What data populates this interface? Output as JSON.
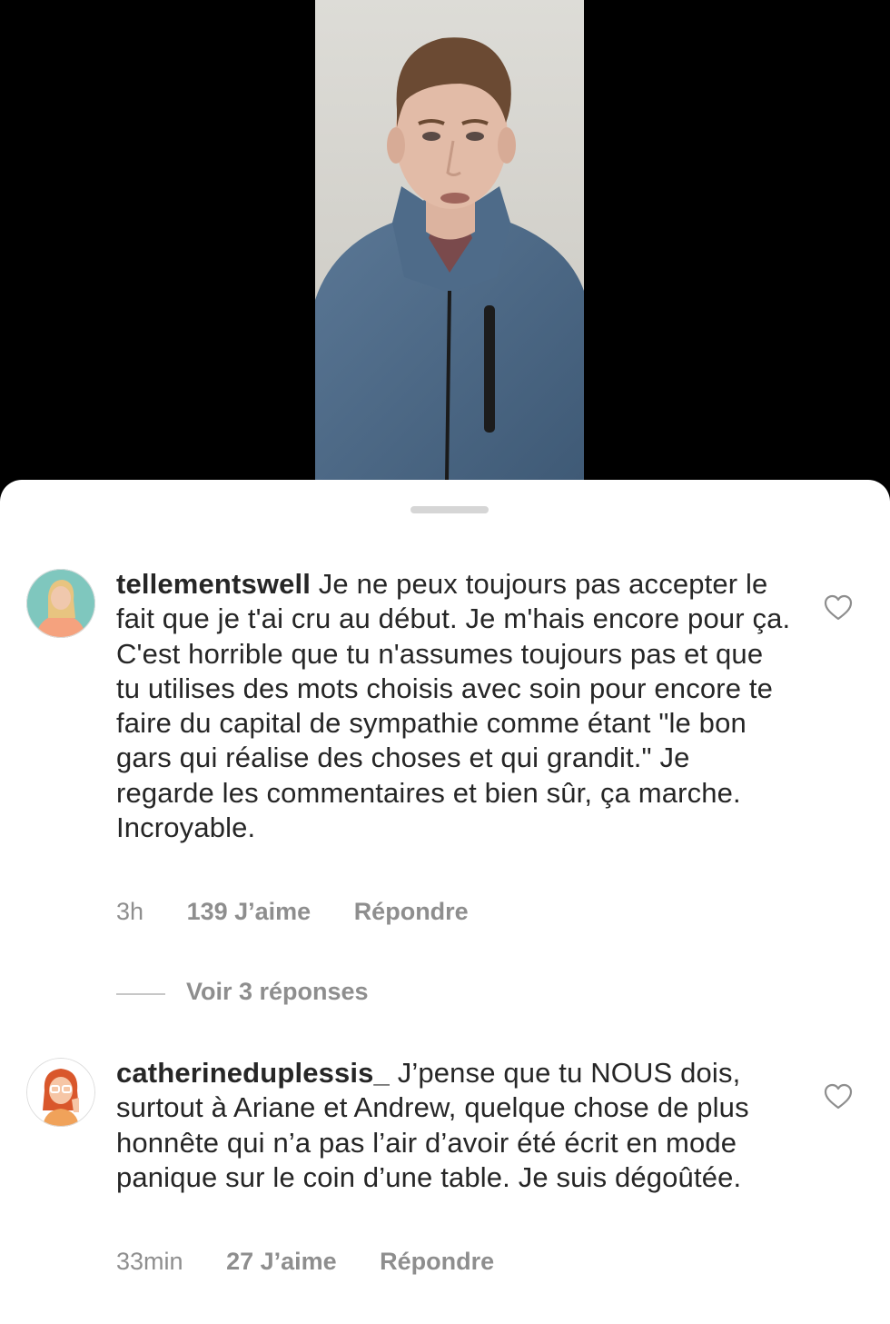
{
  "comments": [
    {
      "username": "tellementswell",
      "text": "Je ne peux toujours pas accepter le fait que je t'ai cru au début. Je m'hais encore pour ça. C'est horrible que tu n'assumes toujours pas et que tu utilises des mots choisis avec soin pour encore te faire du capital de sympathie comme étant \"le bon gars qui réalise des choses et qui grandit.\" Je regarde les commentaires et bien sûr, ça marche. Incroyable.",
      "time": "3h",
      "likes": "139 J’aime",
      "reply_label": "Répondre",
      "view_replies": "Voir 3 réponses"
    },
    {
      "username": "catherineduplessis_",
      "text": "J’pense que tu NOUS dois, surtout à Ariane et Andrew, quelque chose de plus honnête qui n’a pas l’air d’avoir été écrit en mode panique sur le coin d’une table. Je suis dégoûtée.",
      "time": "33min",
      "likes": "27 J’aime",
      "reply_label": "Répondre"
    }
  ],
  "icons": {
    "like": "heart-outline-icon"
  },
  "colors": {
    "text": "#262626",
    "meta": "#8e8e8e",
    "sheet": "#ffffff",
    "background": "#000000"
  }
}
